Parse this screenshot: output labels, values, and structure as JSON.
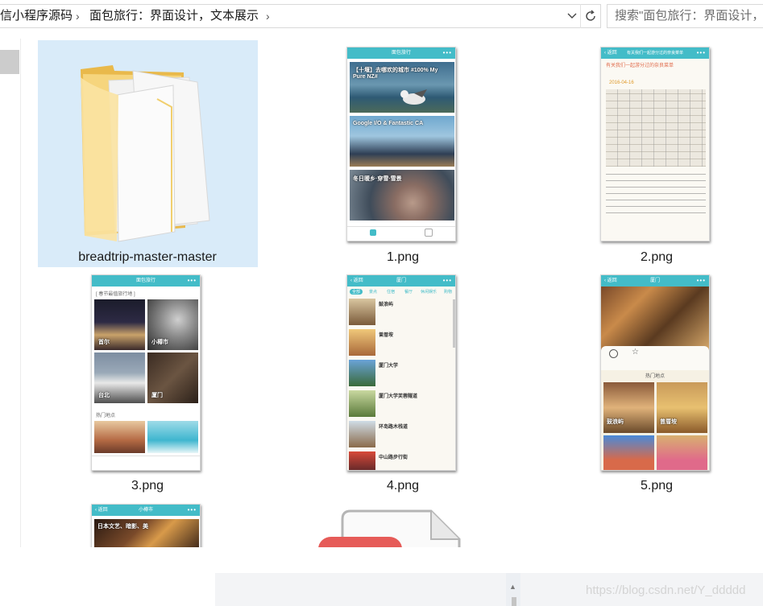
{
  "breadcrumb": {
    "items": [
      "信小程序源码",
      "面包旅行：界面设计，文本展示"
    ],
    "separator": "›",
    "dropdown_icon": "chevron-down-icon",
    "refresh_icon": "refresh-icon"
  },
  "search": {
    "placeholder": "搜索\"面包旅行：界面设计，文"
  },
  "files": [
    {
      "name": "breadtrip-master-master",
      "type": "folder",
      "selected": true
    },
    {
      "name": "1.png",
      "type": "image"
    },
    {
      "name": "2.png",
      "type": "image"
    },
    {
      "name": "3.png",
      "type": "image"
    },
    {
      "name": "4.png",
      "type": "image"
    },
    {
      "name": "5.png",
      "type": "image"
    },
    {
      "name": "",
      "type": "image"
    },
    {
      "name": "",
      "type": "file"
    }
  ],
  "thumbs": {
    "t1": {
      "title": "面包旅行",
      "trip1": "【十堰】去哪欢的城市 #100% My Pure NZ#",
      "trip2": "Google I/O & Fantastic CA",
      "trip3": "冬日暖乡·穿雪·雪景"
    },
    "t2": {
      "title": "有关我们一起游分过的奈良菜单",
      "heading": "有关我们一起游分过的奈良菜单",
      "date": "2016-04-16"
    },
    "t3": {
      "title": "面包旅行",
      "section1": "[ 春节最值旅行地 ]",
      "cities": [
        "首尔",
        "小樽市",
        "台北",
        "厦门"
      ],
      "section2": "热门地点"
    },
    "t4": {
      "title": "厦门",
      "tabs": [
        "全部",
        "景点",
        "住宿",
        "餐厅",
        "休闲娱乐",
        "购物"
      ],
      "places": [
        "鼓浪屿",
        "曾厝垵",
        "厦门大学",
        "厦门大学芙蓉隧道",
        "环岛路木栈道",
        "中山路步行街"
      ]
    },
    "t5": {
      "title": "厦门",
      "section": "热门地点",
      "places": [
        "鼓浪屿",
        "曾厝垵"
      ]
    },
    "t6": {
      "title": "小樽市",
      "caption": "日本文艺、暗影、美"
    }
  },
  "watermark": "https://blog.csdn.net/Y_ddddd",
  "colors": {
    "selection": "#d9ebf9",
    "accent": "#43bcc8",
    "pdf_red": "#e65b58"
  }
}
